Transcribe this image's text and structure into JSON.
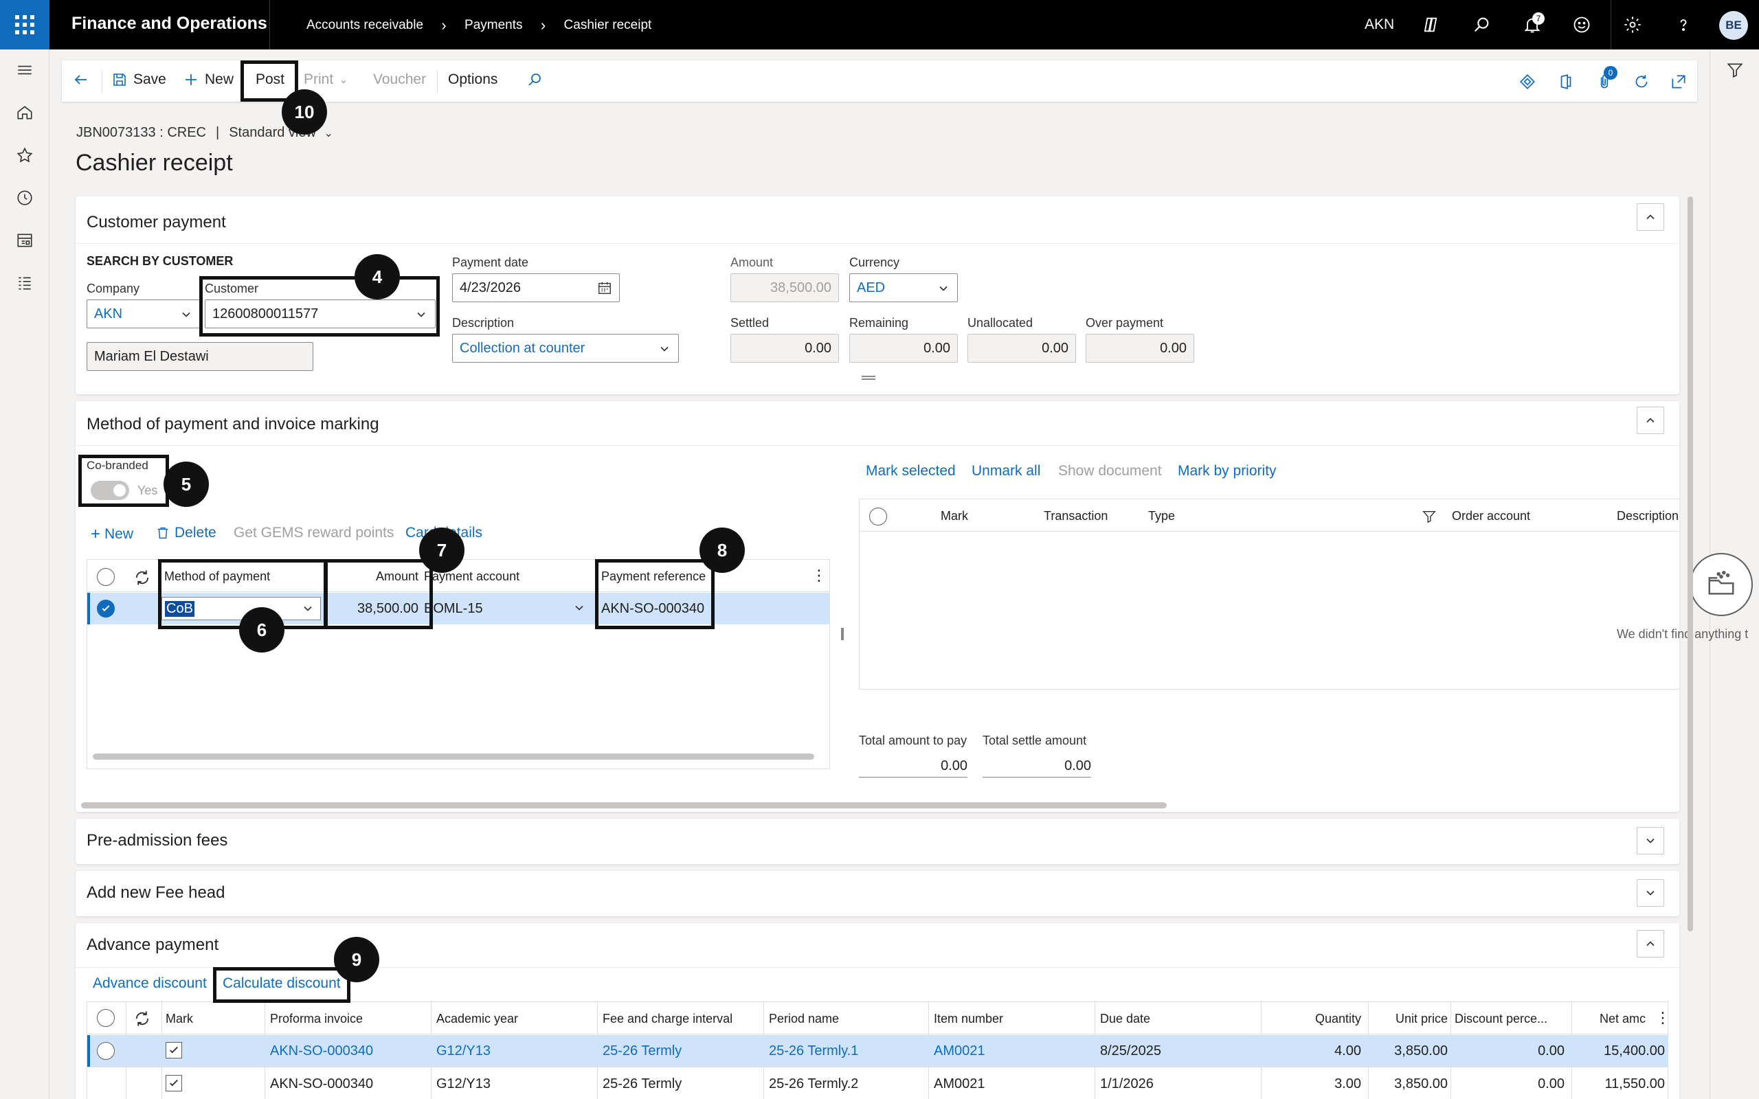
{
  "topbar": {
    "app_title": "Finance and Operations",
    "breadcrumb": [
      "Accounts receivable",
      "Payments",
      "Cashier receipt"
    ],
    "company": "AKN",
    "notification_count": "7",
    "user_initials": "BE"
  },
  "actionpane": {
    "save": "Save",
    "new": "New",
    "post": "Post",
    "print": "Print",
    "voucher": "Voucher",
    "options": "Options",
    "attach_count": "0"
  },
  "header": {
    "record_id": "JBN0073133 : CREC",
    "separator": "|",
    "view": "Standard view",
    "title": "Cashier receipt"
  },
  "customer_payment": {
    "title": "Customer payment",
    "search_heading": "SEARCH BY CUSTOMER",
    "company_label": "Company",
    "company_value": "AKN",
    "customer_label": "Customer",
    "customer_value": "12600800011577",
    "customer_name": "Mariam El Destawi",
    "payment_date_label": "Payment date",
    "payment_date_value": "4/23/2026",
    "description_label": "Description",
    "description_value": "Collection at counter",
    "amount_label": "Amount",
    "amount_value": "38,500.00",
    "currency_label": "Currency",
    "currency_value": "AED",
    "settled_label": "Settled",
    "settled_value": "0.00",
    "remaining_label": "Remaining",
    "remaining_value": "0.00",
    "unallocated_label": "Unallocated",
    "unallocated_value": "0.00",
    "overpayment_label": "Over payment",
    "overpayment_value": "0.00"
  },
  "method_section": {
    "title": "Method of payment and invoice marking",
    "cobranded_label": "Co-branded",
    "cobranded_value": "Yes",
    "new": "New",
    "delete": "Delete",
    "gems": "Get GEMS reward points",
    "card_details": "Card details",
    "columns": {
      "method": "Method of payment",
      "amount": "Amount",
      "account": "Payment account",
      "reference": "Payment reference"
    },
    "row": {
      "method": "CoB",
      "amount": "38,500.00",
      "account": "BOML-15",
      "reference": "AKN-SO-000340"
    },
    "mark_selected": "Mark selected",
    "unmark_all": "Unmark all",
    "show_document": "Show document",
    "mark_by_priority": "Mark by priority",
    "invoice_columns": {
      "mark": "Mark",
      "transaction": "Transaction",
      "type": "Type",
      "order_account": "Order account",
      "description": "Description"
    },
    "empty_message": "We didn't find anything t",
    "total_pay_label": "Total amount to pay",
    "total_pay_value": "0.00",
    "total_settle_label": "Total settle amount",
    "total_settle_value": "0.00"
  },
  "pre_admission": {
    "title": "Pre-admission fees"
  },
  "fee_head": {
    "title": "Add new Fee head"
  },
  "advance_payment": {
    "title": "Advance payment",
    "advance_discount": "Advance discount",
    "calculate_discount": "Calculate discount",
    "columns": [
      "Mark",
      "Proforma invoice",
      "Academic year",
      "Fee and charge interval",
      "Period name",
      "Item number",
      "Due date",
      "Quantity",
      "Unit price",
      "Discount perce...",
      "Net amc"
    ],
    "rows": [
      {
        "invoice": "AKN-SO-000340",
        "year": "G12/Y13",
        "interval": "25-26 Termly",
        "period": "25-26 Termly.1",
        "item": "AM0021",
        "due": "8/25/2025",
        "qty": "4.00",
        "price": "3,850.00",
        "disc": "0.00",
        "net": "15,400.00"
      },
      {
        "invoice": "AKN-SO-000340",
        "year": "G12/Y13",
        "interval": "25-26 Termly",
        "period": "25-26 Termly.2",
        "item": "AM0021",
        "due": "1/1/2026",
        "qty": "3.00",
        "price": "3,850.00",
        "disc": "0.00",
        "net": "11,550.00"
      }
    ]
  },
  "callouts": {
    "c4": "4",
    "c5": "5",
    "c6": "6",
    "c7": "7",
    "c8": "8",
    "c9": "9",
    "c10": "10"
  }
}
